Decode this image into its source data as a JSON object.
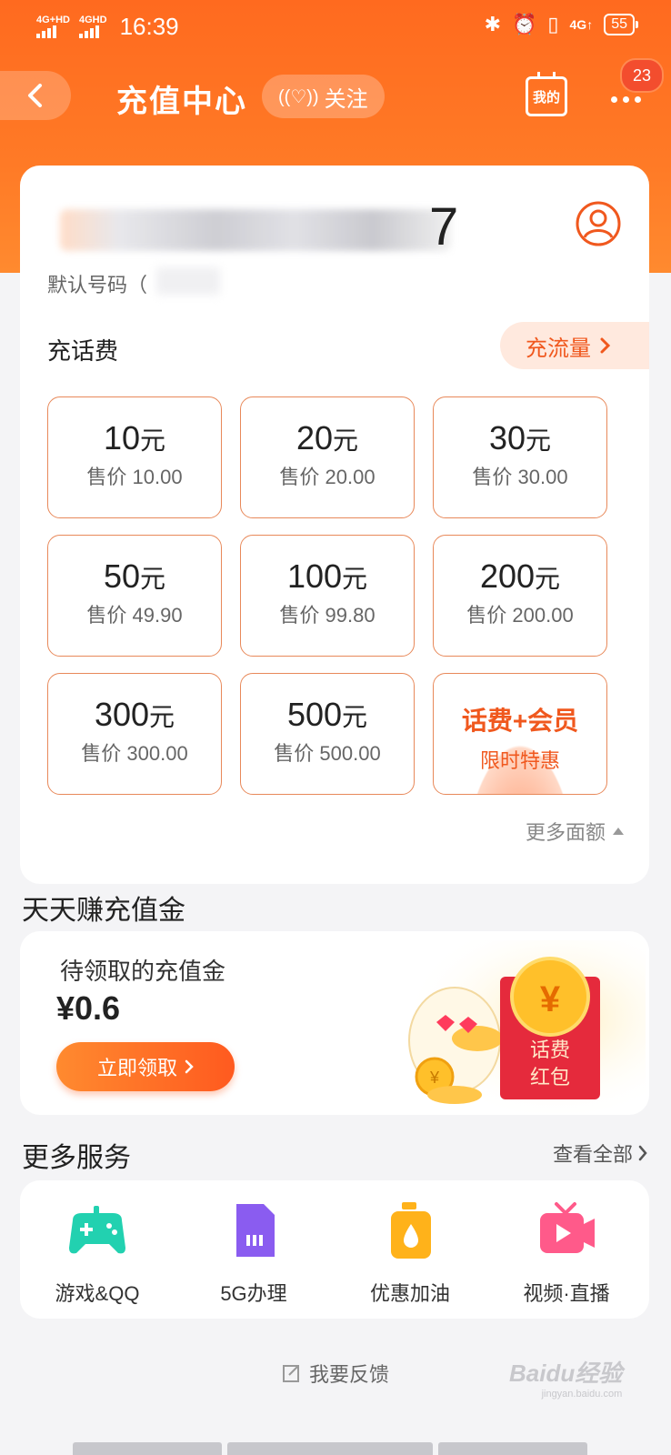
{
  "status": {
    "signal1": "4G+HD",
    "signal2": "4GHD",
    "time": "16:39",
    "net": "4G↑",
    "battery": "55"
  },
  "nav": {
    "title": "充值中心",
    "follow": "关注",
    "mine": "我的",
    "badge": "23"
  },
  "account": {
    "phone_tail": "7",
    "default_label": "默认号码（"
  },
  "recharge": {
    "title": "充话费",
    "flow_button": "充流量",
    "tiles": [
      {
        "amount": "10",
        "unit": "元",
        "price": "售价 10.00"
      },
      {
        "amount": "20",
        "unit": "元",
        "price": "售价 20.00"
      },
      {
        "amount": "30",
        "unit": "元",
        "price": "售价 30.00"
      },
      {
        "amount": "50",
        "unit": "元",
        "price": "售价 49.90"
      },
      {
        "amount": "100",
        "unit": "元",
        "price": "售价 99.80"
      },
      {
        "amount": "200",
        "unit": "元",
        "price": "售价 200.00"
      },
      {
        "amount": "300",
        "unit": "元",
        "price": "售价 300.00"
      },
      {
        "amount": "500",
        "unit": "元",
        "price": "售价 500.00"
      }
    ],
    "promo": {
      "line1": "话费+会员",
      "line2": "限时特惠"
    },
    "more": "更多面额"
  },
  "earn": {
    "title": "天天赚充值金",
    "label": "待领取的充值金",
    "amount": "¥0.6",
    "button": "立即领取",
    "envelope_text1": "话费",
    "envelope_text2": "红包",
    "coin": "¥"
  },
  "services": {
    "title": "更多服务",
    "view_all": "查看全部",
    "items": [
      {
        "label": "游戏&QQ",
        "icon": "gamepad-icon",
        "color": "#22d1b0"
      },
      {
        "label": "5G办理",
        "icon": "sim-card-icon",
        "color": "#8a5cf0"
      },
      {
        "label": "优惠加油",
        "icon": "fuel-can-icon",
        "color": "#ffb21a"
      },
      {
        "label": "视频·直播",
        "icon": "tv-play-icon",
        "color": "#ff5a8a"
      }
    ]
  },
  "feedback": "我要反馈",
  "watermark": {
    "brand": "Baidu经验",
    "site": "jingyan.baidu.com"
  },
  "colors": {
    "accent": "#ff6a1f",
    "accent_text": "#f0581e",
    "tile_border": "#e8895a"
  }
}
